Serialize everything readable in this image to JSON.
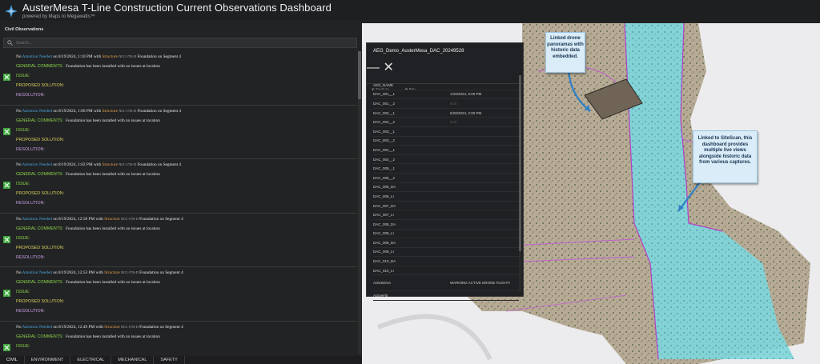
{
  "header": {
    "title": "AusterMesa T-Line Construction Current Observations Dashboard",
    "subtitle": "powered by Maps to Megawatts™"
  },
  "panel": {
    "title": "Civil Observations",
    "search_placeholder": "Search..."
  },
  "observations": [
    {
      "status": "No",
      "attn": "Attention Needed",
      "on": "on",
      "datetime": "8/19/2024, 1:10 PM",
      "with": "with",
      "structure": "Structure",
      "struct_id": "NCC-1701-D",
      "component": "Foundation",
      "on2": "on",
      "segment": "Segment 4",
      "comments_label": "GENERAL COMMENTS:",
      "comments": "Foundation has been installed with no issues at location",
      "issue_label": "ISSUE:",
      "solution_label": "PROPOSED SOLUTION:",
      "resolution_label": "RESOLUTION:"
    },
    {
      "status": "No",
      "attn": "Attention Needed",
      "on": "on",
      "datetime": "8/19/2024, 1:06 PM",
      "with": "with",
      "structure": "Structure",
      "struct_id": "NCC-1701-D",
      "component": "Foundation",
      "on2": "on",
      "segment": "Segment 4",
      "comments_label": "GENERAL COMMENTS:",
      "comments": "Foundation has been installed with no issues at location",
      "issue_label": "ISSUE:",
      "solution_label": "PROPOSED SOLUTION:",
      "resolution_label": "RESOLUTION:"
    },
    {
      "status": "No",
      "attn": "Attention Needed",
      "on": "on",
      "datetime": "8/19/2024, 1:02 PM",
      "with": "with",
      "structure": "Structure",
      "struct_id": "NCC-1701-D",
      "component": "Foundation",
      "on2": "on",
      "segment": "Segment 4",
      "comments_label": "GENERAL COMMENTS:",
      "comments": "Foundation has been installed with no issues at location",
      "issue_label": "ISSUE:",
      "solution_label": "PROPOSED SOLUTION:",
      "resolution_label": "RESOLUTION:"
    },
    {
      "status": "No",
      "attn": "Attention Needed",
      "on": "on",
      "datetime": "8/19/2024, 12:58 PM",
      "with": "with",
      "structure": "Structure",
      "struct_id": "NCC-1701-D",
      "component": "Foundation",
      "on2": "on",
      "segment": "Segment 4",
      "comments_label": "GENERAL COMMENTS:",
      "comments": "Foundation has been installed with no issues at location",
      "issue_label": "ISSUE:",
      "solution_label": "PROPOSED SOLUTION:",
      "resolution_label": "RESOLUTION:"
    },
    {
      "status": "No",
      "attn": "Attention Needed",
      "on": "on",
      "datetime": "8/19/2024, 12:53 PM",
      "with": "with",
      "structure": "Structure",
      "struct_id": "NCC-1701-D",
      "component": "Foundation",
      "on2": "on",
      "segment": "Segment 4",
      "comments_label": "GENERAL COMMENTS:",
      "comments": "Foundation has been installed with no issues at location",
      "issue_label": "ISSUE:",
      "solution_label": "PROPOSED SOLUTION:",
      "resolution_label": "RESOLUTION:"
    },
    {
      "status": "No",
      "attn": "Attention Needed",
      "on": "on",
      "datetime": "8/19/2024, 12:49 PM",
      "with": "with",
      "structure": "Structure",
      "struct_id": "NCC-1701-D",
      "component": "Foundation",
      "on2": "on",
      "segment": "Segment 4",
      "comments_label": "GENERAL COMMENTS:",
      "comments": "Foundation has been installed with no issues at location",
      "issue_label": "ISSUE:",
      "solution_label": "",
      "resolution_label": ""
    }
  ],
  "tabs": [
    "CIVIL",
    "ENVIRONMENT",
    "ELECTRICAL",
    "MECHANICAL",
    "SAFETY"
  ],
  "popup": {
    "title": "AEG_Demo_AusterMesa_DAC_20249528",
    "zoom_label": "Zoom to",
    "pan_label": "Pan",
    "rows": [
      {
        "name": "AEG_NAME",
        "value": ""
      },
      {
        "name": "DAC_001__1",
        "value": "1/15/2024, 6:00 PM"
      },
      {
        "name": "DAC_001__2",
        "value": "Null"
      },
      {
        "name": "DAC_002__1",
        "value": "5/28/2024, 2:00 PM"
      },
      {
        "name": "DAC_002__2",
        "value": "Null"
      },
      {
        "name": "DAC_003__1",
        "value": ""
      },
      {
        "name": "DAC_003__2",
        "value": ""
      },
      {
        "name": "DAC_004__1",
        "value": ""
      },
      {
        "name": "DAC_004__2",
        "value": ""
      },
      {
        "name": "DAC_005__1",
        "value": ""
      },
      {
        "name": "DAC_005__2",
        "value": ""
      },
      {
        "name": "DAC_006_DA",
        "value": ""
      },
      {
        "name": "DAC_006_LI",
        "value": ""
      },
      {
        "name": "DAC_007_DA",
        "value": ""
      },
      {
        "name": "DAC_007_LI",
        "value": ""
      },
      {
        "name": "DAC_008_DA",
        "value": ""
      },
      {
        "name": "DAC_008_LI",
        "value": ""
      },
      {
        "name": "DAC_009_DA",
        "value": ""
      },
      {
        "name": "DAC_009_LI",
        "value": ""
      },
      {
        "name": "DAC_010_DA",
        "value": ""
      },
      {
        "name": "DAC_010_LI",
        "value": ""
      },
      {
        "name": "ActiveDron",
        "value": "WARNING ACTIVE DRONE FLIGHT!"
      },
      {
        "name": "ActiveFlit",
        "value": ""
      }
    ]
  },
  "callouts": {
    "drone": "Linked drone panoramas with historic data embedded.",
    "sitescan": "Linked to SiteScan, this dashboard provides multiple live views alongside historic data from various captures."
  },
  "colors": {
    "accent_blue": "#4aa3d8",
    "accent_orange": "#e3a04a",
    "label_green": "#8bd44a",
    "label_yellow": "#d9d15a",
    "label_pink": "#c79fe0",
    "corridor_cyan": "#7fd6dc"
  }
}
